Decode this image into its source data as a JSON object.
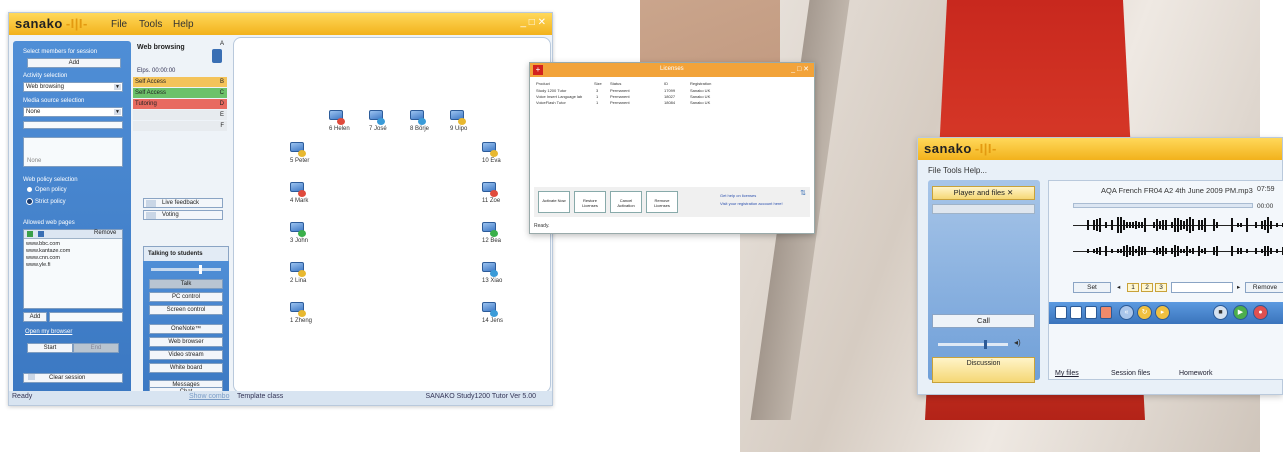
{
  "main_window": {
    "brand": "sanako",
    "menu": [
      "File",
      "Tools",
      "Help"
    ],
    "left_panel": {
      "select_members_label": "Select members for session",
      "add_label": "Add",
      "activity_label": "Activity selection",
      "activity_value": "Web browsing",
      "media_label": "Media source selection",
      "media_value": "None",
      "none_text": "None",
      "web_policy_label": "Web policy selection",
      "open_policy": "Open policy",
      "strict_policy": "Strict policy",
      "allowed_pages_label": "Allowed web pages",
      "remove_label": "Remove",
      "pages": [
        "www.bbc.com",
        "www.kantaze.com",
        "www.cnn.com",
        "www.yle.fi"
      ],
      "add_page_label": "Add",
      "open_browser_link": "Open my browser",
      "start_label": "Start",
      "end_label": "End",
      "clear_session_label": "Clear session"
    },
    "mid_panel": {
      "title": "Web browsing",
      "elapsed": "Elps. 00:00:00",
      "rows": [
        {
          "label": "Self Access",
          "key": "B",
          "color": "#f4c35a"
        },
        {
          "label": "Self Access",
          "key": "C",
          "color": "#6cc26a"
        },
        {
          "label": "Tutoring",
          "key": "D",
          "color": "#e86a60"
        },
        {
          "label": "",
          "key": "E",
          "color": "#e7ebef"
        },
        {
          "label": "",
          "key": "F",
          "color": "#e7ebef"
        }
      ],
      "live_feedback": "Live feedback",
      "voting": "Voting",
      "talking_to_students": "Talking to students",
      "buttons": [
        "Talk",
        "PC control",
        "Screen control",
        "OneNote™",
        "Web browser",
        "Video stream",
        "White board",
        "Messages",
        "Chat"
      ]
    },
    "students": [
      {
        "name": "6 Helen",
        "color": "#e04a3c"
      },
      {
        "name": "7 José",
        "color": "#3a9bd8"
      },
      {
        "name": "8 Börje",
        "color": "#3a9bd8"
      },
      {
        "name": "9 Uipo",
        "color": "#e8b830"
      },
      {
        "name": "5 Peter",
        "color": "#e8b830"
      },
      {
        "name": "10 Eva",
        "color": "#e8b830"
      },
      {
        "name": "4 Mark",
        "color": "#e04a3c"
      },
      {
        "name": "11 Zoe",
        "color": "#e04a3c"
      },
      {
        "name": "3 John",
        "color": "#3ab04a"
      },
      {
        "name": "12 Bea",
        "color": "#3ab04a"
      },
      {
        "name": "2 Lina",
        "color": "#e8b830"
      },
      {
        "name": "13 Xiao",
        "color": "#3a9bd8"
      },
      {
        "name": "1 Zheng",
        "color": "#e8b830"
      },
      {
        "name": "14 Jens",
        "color": "#3a9bd8"
      }
    ],
    "status_left": "Ready",
    "status_combo": "Show combo",
    "template_class": "Template class",
    "version": "SANAKO Study1200 Tutor Ver 5.00"
  },
  "licenses_window": {
    "title": "Licenses",
    "columns": [
      "Product",
      "Size",
      "Status",
      "ID",
      "Registration"
    ],
    "rows": [
      [
        "Study 1200 Tutor",
        "3",
        "Permanent",
        "17099",
        "Sanako UK"
      ],
      [
        "Voice Insert Language lab",
        "1",
        "Permanent",
        "18027",
        "Sanako UK"
      ],
      [
        "VoiceFlash Tutor",
        "1",
        "Permanent",
        "18084",
        "Sanako UK"
      ]
    ],
    "buttons": [
      "Activate Now",
      "Restore Licenses",
      "Cancel Activation",
      "Remove Licenses"
    ],
    "help_link": "Get help on licenses",
    "visit_link": "Visit your registration account here!",
    "status": "Ready."
  },
  "student_window": {
    "brand": "sanako",
    "menu": "File Tools Help...",
    "player_files": "Player and files",
    "call": "Call",
    "discussion": "Discussion",
    "track_title": "AQA French FR04 A2 4th June 2009 PM.mp3",
    "duration": "07:59",
    "position": "00:00",
    "progress": 0.0,
    "set_label": "Set",
    "pages": [
      "1",
      "2",
      "3"
    ],
    "remove_label": "Remove",
    "tabs": [
      "My files",
      "Session files",
      "Homework"
    ]
  }
}
